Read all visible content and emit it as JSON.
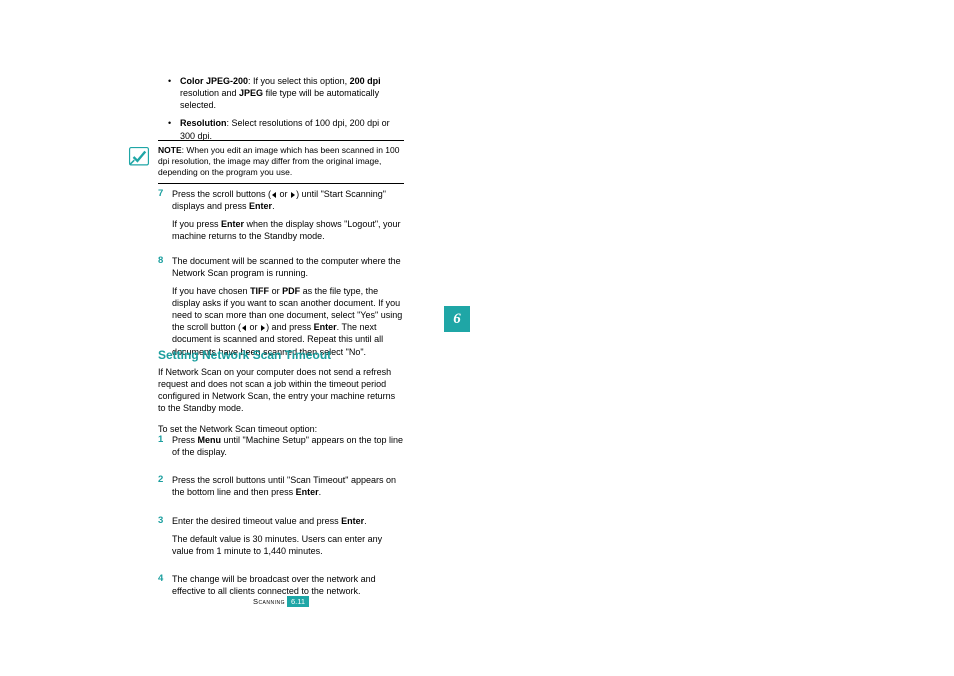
{
  "chapter_tab": "6",
  "bullets": [
    {
      "label": "Color JPEG-200",
      "text_before": ": If you select this option, ",
      "bold1": "200 dpi",
      "text_mid": " resolution and ",
      "bold2": "JPEG",
      "text_after": " file type will be automatically selected."
    },
    {
      "label": "Resolution",
      "text": ": Select resolutions of 100 dpi, 200 dpi or 300 dpi."
    }
  ],
  "note": {
    "label": "NOTE",
    "text": ": When you edit an image which has been scanned in 100 dpi resolution, the image may differ from the original image, depending on the program you use."
  },
  "steps_a": [
    {
      "num": "7",
      "p1_a": "Press the scroll buttons (",
      "p1_b": " or ",
      "p1_c": ") until \"Start Scanning\" displays and press ",
      "p1_bold": "Enter",
      "p1_d": ".",
      "p2_a": "If you press ",
      "p2_bold": "Enter",
      "p2_b": " when the display shows \"Logout\", your machine returns to the Standby mode."
    },
    {
      "num": "8",
      "p1": "The document will be scanned to the computer where the Network Scan program is running.",
      "p2_a": "If you have chosen ",
      "p2_b1": "TIFF",
      "p2_b": " or ",
      "p2_b2": "PDF",
      "p2_c": " as the file type, the display asks if you want to scan another document. If you need to scan more than one document, select \"Yes\" using the scroll button (",
      "p2_d": " or ",
      "p2_e": ") and press ",
      "p2_b3": "Enter",
      "p2_f": ". The next document is scanned and stored. Repeat this until all documents have been scanned then select \"No\"."
    }
  ],
  "heading": "Setting Network Scan Timeout",
  "intro": {
    "p1": "If Network Scan on your computer does not send a refresh request and does not scan a job within the timeout period configured in Network Scan, the entry your machine returns to the Standby mode.",
    "p2": "To set the Network Scan timeout option:"
  },
  "steps_b": [
    {
      "num": "1",
      "p1_a": "Press ",
      "p1_bold": "Menu",
      "p1_b": " until \"Machine Setup\" appears on the top line of the display."
    },
    {
      "num": "2",
      "p1_a": "Press the scroll buttons until \"Scan Timeout\" appears on the bottom line and then press ",
      "p1_bold": "Enter",
      "p1_b": "."
    },
    {
      "num": "3",
      "p1_a": "Enter the desired timeout value and press ",
      "p1_bold": "Enter",
      "p1_b": ".",
      "p2": "The default value is 30 minutes. Users can enter any value from 1 minute to 1,440 minutes."
    },
    {
      "num": "4",
      "p1": "The change will be broadcast over the network and effective to all clients connected to the network."
    }
  ],
  "footer": {
    "section": "Scanning",
    "page": "6.11"
  }
}
